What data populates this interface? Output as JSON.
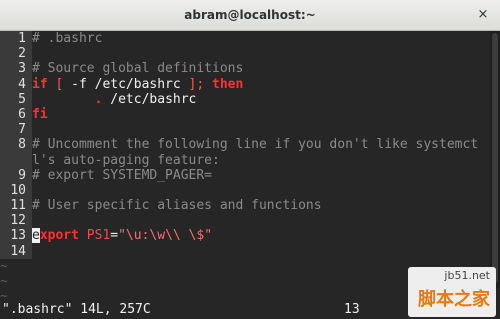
{
  "window": {
    "title": "abram@localhost:~",
    "close_glyph": "×"
  },
  "editor": {
    "lines": [
      {
        "num": "1",
        "segments": [
          {
            "cls": "c-comment",
            "text": "# .bashrc"
          }
        ]
      },
      {
        "num": "2",
        "segments": []
      },
      {
        "num": "3",
        "segments": [
          {
            "cls": "c-comment",
            "text": "# Source global definitions"
          }
        ]
      },
      {
        "num": "4",
        "segments": [
          {
            "cls": "c-kw",
            "text": "if"
          },
          {
            "cls": "c-punct",
            "text": " [ "
          },
          {
            "cls": "c-text",
            "text": "-f /etc/bashrc "
          },
          {
            "cls": "c-punct",
            "text": "];"
          },
          {
            "cls": "c-text",
            "text": " "
          },
          {
            "cls": "c-kw",
            "text": "then"
          }
        ]
      },
      {
        "num": "5",
        "segments": [
          {
            "cls": "c-text",
            "text": "        "
          },
          {
            "cls": "c-kw",
            "text": "."
          },
          {
            "cls": "c-text",
            "text": " /etc/bashrc"
          }
        ]
      },
      {
        "num": "6",
        "segments": [
          {
            "cls": "c-kw",
            "text": "fi"
          }
        ]
      },
      {
        "num": "7",
        "segments": []
      },
      {
        "num": "8",
        "segments": [
          {
            "cls": "c-comment",
            "text": "# Uncomment the following line if you don't like systemct"
          }
        ]
      },
      {
        "num": "",
        "wrap": true,
        "segments": [
          {
            "cls": "c-comment",
            "text": "l's auto-paging feature:"
          }
        ]
      },
      {
        "num": "9",
        "segments": [
          {
            "cls": "c-comment",
            "text": "# export SYSTEMD_PAGER="
          }
        ]
      },
      {
        "num": "10",
        "segments": []
      },
      {
        "num": "11",
        "segments": [
          {
            "cls": "c-comment",
            "text": "# User specific aliases and functions"
          }
        ]
      },
      {
        "num": "12",
        "segments": []
      },
      {
        "num": "13",
        "segments": [
          {
            "cls": "cursor",
            "text": "e"
          },
          {
            "cls": "c-kw",
            "text": "xport"
          },
          {
            "cls": "c-text",
            "text": " "
          },
          {
            "cls": "c-var",
            "text": "PS1"
          },
          {
            "cls": "c-text",
            "text": "="
          },
          {
            "cls": "c-str",
            "text": "\"\\u:\\w\\\\ \\$\""
          }
        ]
      },
      {
        "num": "14",
        "segments": []
      }
    ],
    "tildes": [
      "~",
      "~",
      "~"
    ]
  },
  "status": {
    "message": "\".bashrc\" 14L, 257C",
    "position": "13"
  },
  "watermark": {
    "site": "jb51.net",
    "brand": "脚本之家"
  }
}
